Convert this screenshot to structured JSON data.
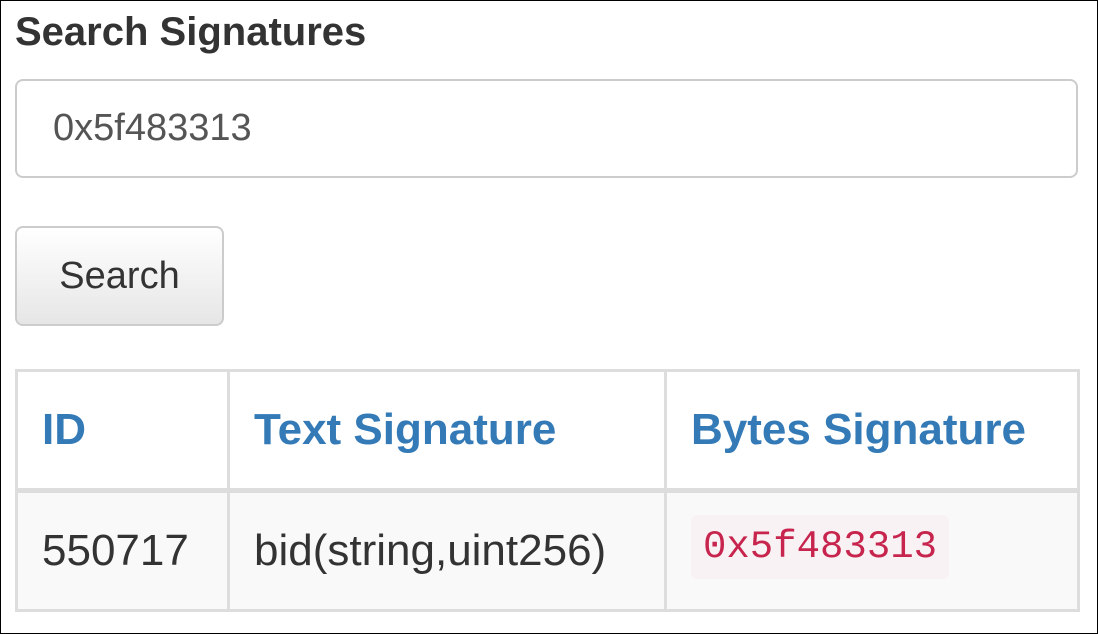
{
  "page": {
    "title": "Search Signatures"
  },
  "search": {
    "value": "0x5f483313",
    "button_label": "Search"
  },
  "table": {
    "headers": [
      "ID",
      "Text Signature",
      "Bytes Signature"
    ],
    "rows": [
      {
        "id": "550717",
        "text_signature": "bid(string,uint256)",
        "bytes_signature": "0x5f483313"
      }
    ]
  },
  "colors": {
    "header_link": "#337ab7",
    "code_text": "#c7254e",
    "code_background": "#f9f2f4",
    "row_background": "#f9f9f9",
    "border": "#dddddd"
  }
}
